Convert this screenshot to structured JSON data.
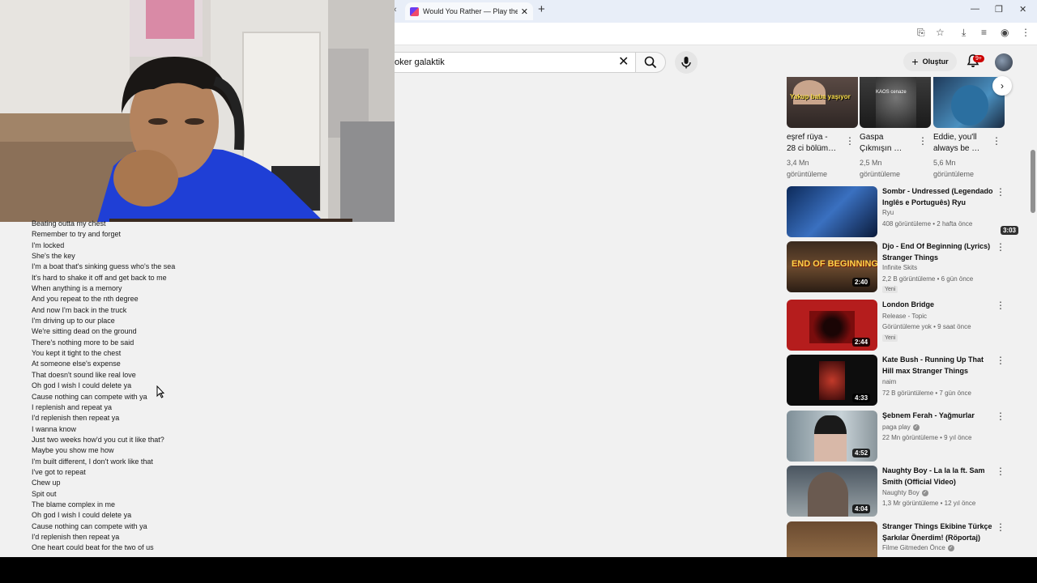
{
  "browser": {
    "tab_title": "Would You Rather — Play the C",
    "tab_prev_icon": "chevron-left-icon",
    "new_tab": "+",
    "window_controls": [
      "—",
      "❐",
      "✕"
    ]
  },
  "youtube": {
    "search_value": "oker galaktik",
    "create_label": "Oluştur",
    "notif_count": "9+"
  },
  "lyrics": [
    "Beating outta my chest",
    "Remember to try and forget",
    "I'm locked",
    "She's the key",
    "I'm a boat that's sinking guess who's the sea",
    "It's hard to shake it off and get back to me",
    "When anything is a memory",
    "And you repeat to the nth degree",
    "And now I'm back in the truck",
    "I'm driving up to our place",
    "We're sitting dead on the ground",
    "There's nothing more to be said",
    "You kept it tight to the chest",
    "At someone else's expense",
    "That doesn't sound like real love",
    "Oh god I wish I could delete ya",
    "Cause nothing can compete with ya",
    "I replenish and repeat ya",
    "I'd replenish then repeat ya",
    "I wanna know",
    "Just two weeks how'd you cut it like that?",
    "Maybe you show me how",
    "I'm built different, I don't work like that",
    "I've got to repeat",
    "Chew up",
    "Spit out",
    "The blame complex in me",
    "Oh god I wish I could delete ya",
    "Cause nothing can compete with ya",
    "I'd replenish then repeat ya",
    "One heart could beat for the two of us"
  ],
  "shorts": [
    {
      "title1": "eşref rüya -",
      "title2": "28 ci bölüm…",
      "views": "3,4 Mn",
      "views_label": "görüntüleme",
      "thumb_text": "Yakup baba yaşıyor"
    },
    {
      "title1": "Gaspa",
      "title2": "Çıkmışın …",
      "views": "2,5 Mn",
      "views_label": "görüntüleme",
      "thumb_text": "KAOS cenaze"
    },
    {
      "title1": "Eddie, you'll",
      "title2": "always be …",
      "views": "5,6 Mn",
      "views_label": "görüntüleme",
      "thumb_text": ""
    }
  ],
  "videos": [
    {
      "title": "Sombr - Undressed (Legendado Inglês e Português) Ryu",
      "channel": "Ryu",
      "meta": "408 görüntüleme • 2 hafta önce",
      "duration": "3:03",
      "new": "",
      "verified": false
    },
    {
      "title": "Djo - End Of Beginning (Lyrics) Stranger Things",
      "channel": "Infinite Skits",
      "meta": "2,2 B görüntüleme • 6 gün önce",
      "duration": "2:40",
      "new": "Yeni",
      "verified": false,
      "thumb_text": "END OF BEGINNING"
    },
    {
      "title": "London Bridge",
      "channel": "Release - Topic",
      "meta": "Görüntüleme yok • 9 saat önce",
      "duration": "2:44",
      "new": "Yeni",
      "verified": false
    },
    {
      "title": "Kate Bush - Running Up That Hill max Stranger Things",
      "channel": "naim",
      "meta": "72 B görüntüleme • 7 gün önce",
      "duration": "4:33",
      "new": "",
      "verified": false
    },
    {
      "title": "Şebnem Ferah - Yağmurlar",
      "channel": "paga play",
      "meta": "22 Mn görüntüleme • 9 yıl önce",
      "duration": "4:52",
      "new": "",
      "verified": true
    },
    {
      "title": "Naughty Boy - La la la ft. Sam Smith (Official Video)",
      "channel": "Naughty Boy",
      "meta": "1,3 Mr görüntüleme • 12 yıl önce",
      "duration": "4:04",
      "new": "",
      "verified": true
    },
    {
      "title": "Stranger Things Ekibine Türkçe Şarkılar Önerdim! (Röportaj)",
      "channel": "Filme Gitmeden Önce",
      "meta": "",
      "duration": "",
      "new": "",
      "verified": true
    }
  ],
  "colors": {
    "accent": "#cc0000",
    "page_bg": "#f1f1f1",
    "tab_strip": "#e8eef8",
    "hoodie": "#1f3fd6"
  }
}
